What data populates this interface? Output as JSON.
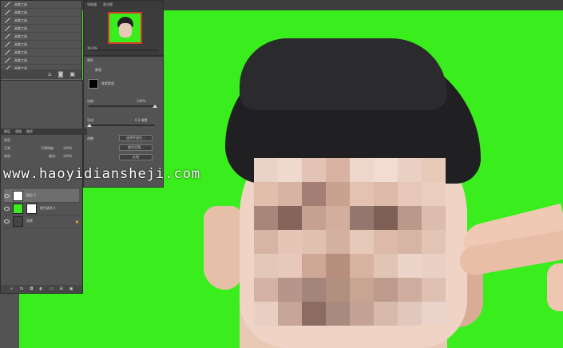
{
  "history": {
    "items": [
      "画笔工具",
      "画笔工具",
      "画笔工具",
      "画笔工具",
      "画笔工具",
      "画笔工具",
      "画笔工具",
      "画笔工具",
      "画笔工具",
      "画笔工具"
    ],
    "active_index": 9
  },
  "navigator": {
    "tabs": [
      "导航器",
      "直方图"
    ],
    "zoom": "16.6%"
  },
  "properties": {
    "title": "属性",
    "mask_label": "蒙版",
    "pixel_mask_label": "像素蒙版",
    "density_label": "浓度:",
    "density_value": "100%",
    "feather_label": "羽化:",
    "feather_value": "0.0 像素",
    "refine_label": "调整:",
    "btn_select_mask": "选择并遮住...",
    "btn_color_range": "颜色范围...",
    "btn_invert": "反相"
  },
  "layers": {
    "tabs": [
      "图层",
      "通道",
      "路径"
    ],
    "kind_label": "类型",
    "blend_mode": "正常",
    "opacity_label": "不透明度:",
    "opacity_value": "100%",
    "lock_label": "锁定:",
    "fill_label": "填充:",
    "fill_value": "100%",
    "rows": [
      {
        "name": "图层 3",
        "thumb": "#ffffff"
      },
      {
        "name": "颜色填充 1",
        "thumb": "#39ee1c"
      },
      {
        "name": "背景",
        "thumb": "#444444"
      }
    ]
  },
  "watermark": "www.haoyidiansheji.com",
  "mosaic_colors": [
    "#e9d3c6",
    "#efd9cd",
    "#e3c4b4",
    "#d9b3a2",
    "#eed7ca",
    "#f0dcd1",
    "#ead0c3",
    "#e8cab9",
    "#e1beab",
    "#d8b3a3",
    "#a47d74",
    "#c9a18f",
    "#e4c2b2",
    "#ddbaa8",
    "#e6c7b8",
    "#e9cdbf",
    "#a8877b",
    "#84645b",
    "#c6a191",
    "#d4ae9c",
    "#94776e",
    "#7e5f56",
    "#bb998a",
    "#dcbcac",
    "#d7b5a4",
    "#e4c5b6",
    "#e0c0af",
    "#d4b0a0",
    "#e6c8b9",
    "#dcb9a9",
    "#d6b5a5",
    "#e3c5b6",
    "#e3c7b8",
    "#e6c9ba",
    "#cfa796",
    "#b88e7c",
    "#d7b3a2",
    "#e2c4b5",
    "#ecd4c8",
    "#e9d0c3",
    "#d4b2a3",
    "#b6958a",
    "#a4857c",
    "#b2907f",
    "#c8a493",
    "#bd9a8b",
    "#cfae9f",
    "#dec1b3",
    "#e8cfc2",
    "#c7a698",
    "#8c6c62",
    "#a98a7f",
    "#c4a395",
    "#d7baac",
    "#e2c8bc",
    "#ead3c8"
  ]
}
